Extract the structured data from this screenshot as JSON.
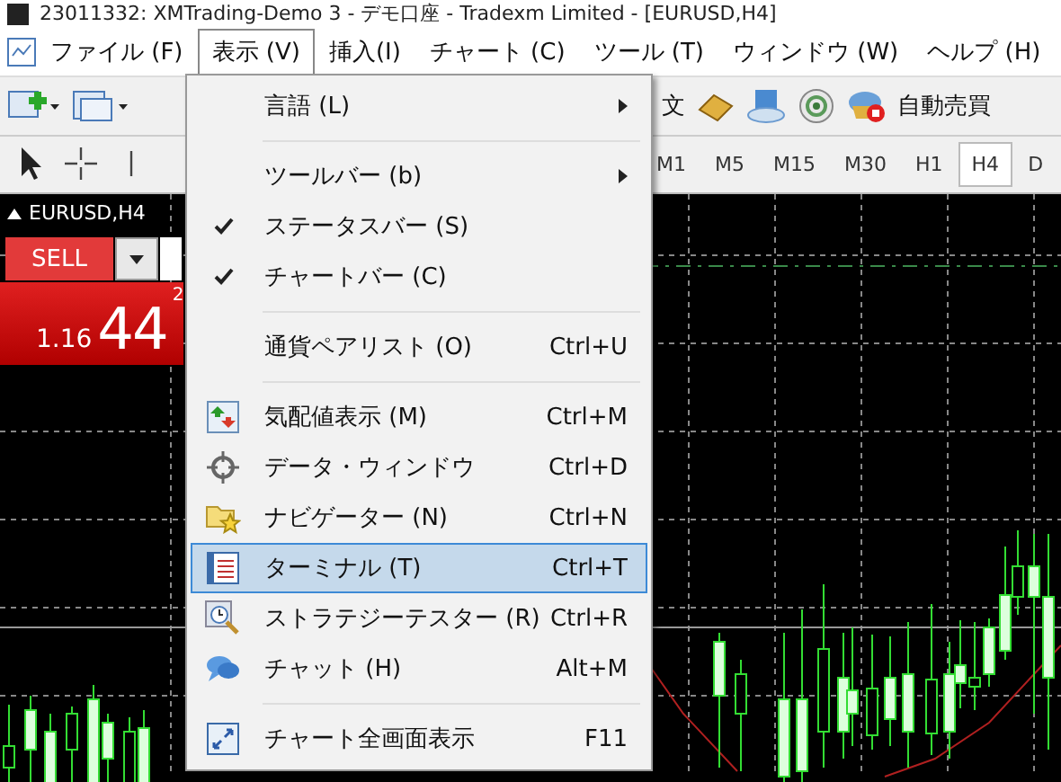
{
  "window": {
    "title": "23011332: XMTrading-Demo 3 - デモ口座 - Tradexm Limited - [EURUSD,H4]"
  },
  "menu_bar": [
    {
      "label": "ファイル (F)",
      "selected": false
    },
    {
      "label": "表示 (V)",
      "selected": true
    },
    {
      "label": "挿入(I)",
      "selected": false
    },
    {
      "label": "チャート (C)",
      "selected": false
    },
    {
      "label": "ツール (T)",
      "selected": false
    },
    {
      "label": "ウィンドウ (W)",
      "selected": false
    },
    {
      "label": "ヘルプ (H)",
      "selected": false
    }
  ],
  "toolbar": {
    "order_text": "文",
    "auto_trading": "自動売買"
  },
  "timeframes": [
    {
      "label": "M1",
      "selected": false
    },
    {
      "label": "M5",
      "selected": false
    },
    {
      "label": "M15",
      "selected": false
    },
    {
      "label": "M30",
      "selected": false
    },
    {
      "label": "H1",
      "selected": false
    },
    {
      "label": "H4",
      "selected": true
    },
    {
      "label": "D",
      "selected": false
    }
  ],
  "chart": {
    "symbol": "EURUSD,H4",
    "sell_button": "SELL",
    "price_prefix": "1.16",
    "price_main": "44",
    "price_sup": "2"
  },
  "dropdown": [
    {
      "kind": "submenu",
      "label": "言語 (L)",
      "checked": false,
      "selected": false
    },
    {
      "kind": "separator"
    },
    {
      "kind": "submenu",
      "label": "ツールバー (b)",
      "checked": false,
      "selected": false
    },
    {
      "kind": "item",
      "label": "ステータスバー (S)",
      "checked": true,
      "selected": false
    },
    {
      "kind": "item",
      "label": "チャートバー (C)",
      "checked": true,
      "selected": false
    },
    {
      "kind": "separator"
    },
    {
      "kind": "item",
      "label": "通貨ペアリスト (O)",
      "shortcut": "Ctrl+U",
      "checked": false,
      "selected": false
    },
    {
      "kind": "separator"
    },
    {
      "kind": "icon_item",
      "label": "気配値表示 (M)",
      "shortcut": "Ctrl+M",
      "checked": false,
      "selected": false
    },
    {
      "kind": "icon_item",
      "label": "データ・ウィンドウ",
      "shortcut": "Ctrl+D",
      "checked": false,
      "selected": false
    },
    {
      "kind": "icon_item",
      "label": "ナビゲーター (N)",
      "shortcut": "Ctrl+N",
      "checked": false,
      "selected": false
    },
    {
      "kind": "icon_item",
      "label": "ターミナル (T)",
      "shortcut": "Ctrl+T",
      "checked": false,
      "selected": true
    },
    {
      "kind": "icon_item",
      "label": "ストラテジーテスター (R)",
      "shortcut": "Ctrl+R",
      "checked": false,
      "selected": false
    },
    {
      "kind": "icon_item",
      "label": "チャット (H)",
      "shortcut": "Alt+M",
      "checked": false,
      "selected": false
    },
    {
      "kind": "separator"
    },
    {
      "kind": "icon_item",
      "label": "チャート全画面表示",
      "shortcut": "F11",
      "checked": false,
      "selected": false
    }
  ]
}
